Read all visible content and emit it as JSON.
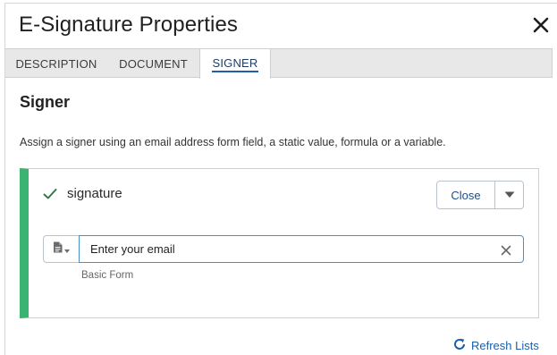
{
  "dialog": {
    "title": "E-Signature Properties",
    "close_icon": "close-icon"
  },
  "tabs": [
    {
      "label": "DESCRIPTION",
      "active": false
    },
    {
      "label": "DOCUMENT",
      "active": false
    },
    {
      "label": "SIGNER",
      "active": true
    }
  ],
  "section": {
    "title": "Signer",
    "description": "Assign a signer using an email address form field, a static value, formula or a variable."
  },
  "signer_card": {
    "status_icon": "check-icon",
    "name": "signature",
    "close_label": "Close",
    "menu_icon": "caret-down-icon",
    "field_type_icon": "document-icon",
    "email_placeholder": "Enter your email",
    "email_value": "",
    "clear_icon": "clear-icon",
    "source_form": "Basic Form"
  },
  "footer": {
    "refresh_label": "Refresh Lists",
    "refresh_icon": "refresh-icon"
  },
  "colors": {
    "accent_green": "#3cb371",
    "link_blue": "#1a5fa8",
    "tab_bg": "#e8e8e8",
    "input_border": "#4a90c8"
  }
}
